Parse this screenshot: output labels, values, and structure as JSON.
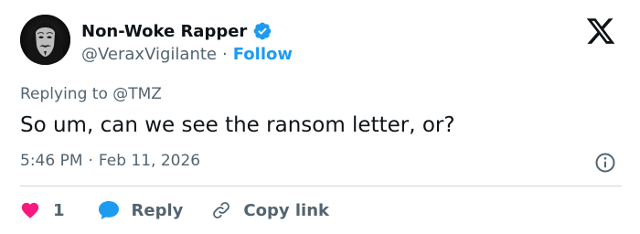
{
  "author": {
    "display_name": "Non-Woke Rapper",
    "handle": "@VeraxVigilante",
    "separator": "·",
    "follow_label": "Follow",
    "verified_color": "#1d9bf0"
  },
  "tweet": {
    "replying_prefix": "Replying to ",
    "replying_to": "@TMZ",
    "text": "So um, can we see the ransom letter, or?",
    "time": "5:46 PM",
    "meta_separator": "·",
    "date": "Feb 11, 2026"
  },
  "actions": {
    "like_count": "1",
    "reply_label": "Reply",
    "copy_label": "Copy link"
  },
  "colors": {
    "like": "#f91880",
    "reply": "#1d9bf0",
    "link": "#1d9bf0",
    "muted": "#536471",
    "text": "#0f1419",
    "divider": "#cfd9de"
  },
  "icons": [
    "anonymous-mask-avatar",
    "verified-badge-icon",
    "x-logo-icon",
    "info-icon",
    "heart-icon",
    "reply-bubble-icon",
    "link-icon"
  ]
}
